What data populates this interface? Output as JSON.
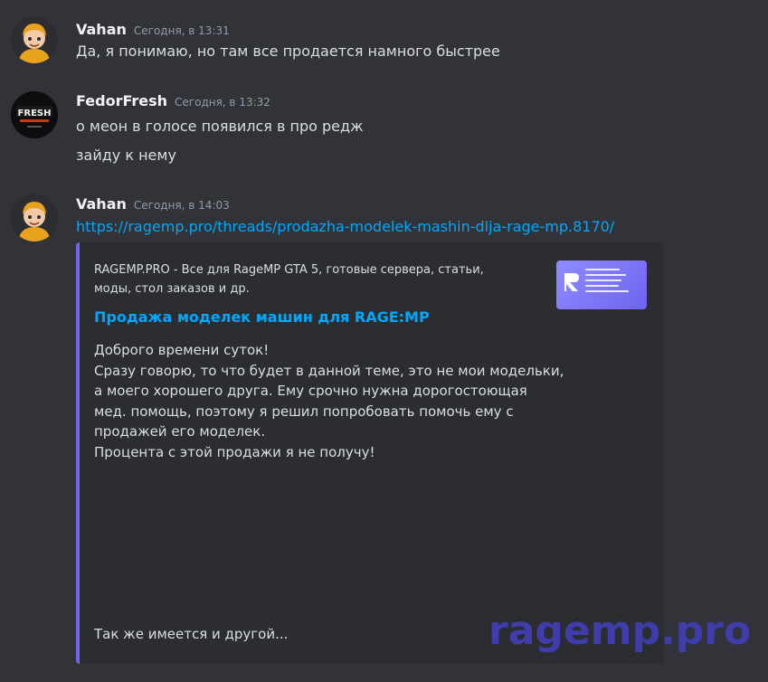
{
  "messages": [
    {
      "author": "Vahan",
      "timestamp": "Сегодня, в 13:31",
      "lines": [
        "Да, я понимаю, но там все продается намного быстрее"
      ]
    },
    {
      "author": "FedorFresh",
      "timestamp": "Сегодня, в 13:32",
      "lines": [
        "о меон в голосе появился в про редж",
        "зайду к нему"
      ],
      "avatar_text": "FRESH"
    },
    {
      "author": "Vahan",
      "timestamp": "Сегодня, в 14:03",
      "link": "https://ragemp.pro/threads/prodazha-modelek-mashin-dlja-rage-mp.8170/"
    }
  ],
  "embed": {
    "provider": "RAGEMP.PRO - Все для RageMP GTA 5, готовые сервера, статьи, моды, стол заказов и др.",
    "title": "Продажа моделек машин для RAGE:MP",
    "description": [
      "Доброго времени суток!",
      "Сразу говорю, то что будет в данной теме, это не мои модельки,",
      "а моего хорошего друга. Ему срочно нужна дорогостоющая",
      "мед. помощь, поэтому я решил попробовать помочь ему с",
      "продажей его моделек.",
      "Процента с этой продажи я не получу!"
    ],
    "footer": "Так же имеется и другой...",
    "thumbnail": "ragemp-pro-thumbnail",
    "accent_color": "#6f66f3"
  },
  "watermark": "ragemp.pro",
  "colors": {
    "background": "#313338",
    "link": "#00a8fc",
    "embed_bg": "#2b2d31"
  }
}
